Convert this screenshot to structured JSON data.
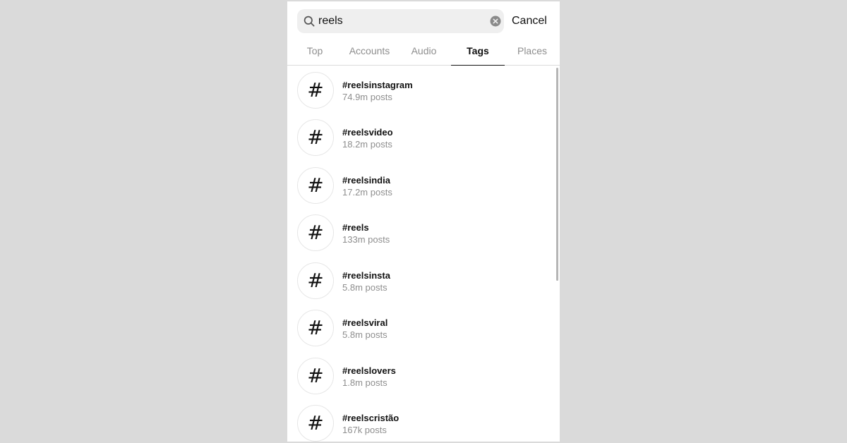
{
  "search": {
    "value": "reels",
    "cancel_label": "Cancel"
  },
  "tabs": [
    {
      "label": "Top",
      "active": false
    },
    {
      "label": "Accounts",
      "active": false
    },
    {
      "label": "Audio",
      "active": false
    },
    {
      "label": "Tags",
      "active": true
    },
    {
      "label": "Places",
      "active": false
    }
  ],
  "results": [
    {
      "symbol": "#",
      "name": "#reelsinstagram",
      "count": "74.9m posts"
    },
    {
      "symbol": "#",
      "name": "#reelsvideo",
      "count": "18.2m posts"
    },
    {
      "symbol": "#",
      "name": "#reelsindia",
      "count": "17.2m posts"
    },
    {
      "symbol": "#",
      "name": "#reels",
      "count": "133m posts"
    },
    {
      "symbol": "#",
      "name": "#reelsinsta",
      "count": "5.8m posts"
    },
    {
      "symbol": "#",
      "name": "#reelsviral",
      "count": "5.8m posts"
    },
    {
      "symbol": "#",
      "name": "#reelslovers",
      "count": "1.8m posts"
    },
    {
      "symbol": "#",
      "name": "#reelscristão",
      "count": "167k posts"
    }
  ],
  "icons": {
    "search": "search-icon",
    "clear": "clear-icon",
    "tag": "hashtag-icon"
  },
  "colors": {
    "background": "#dadada",
    "panel": "#ffffff",
    "search_field": "#efefef",
    "text_primary": "#111111",
    "text_secondary": "#8e8e8e"
  }
}
